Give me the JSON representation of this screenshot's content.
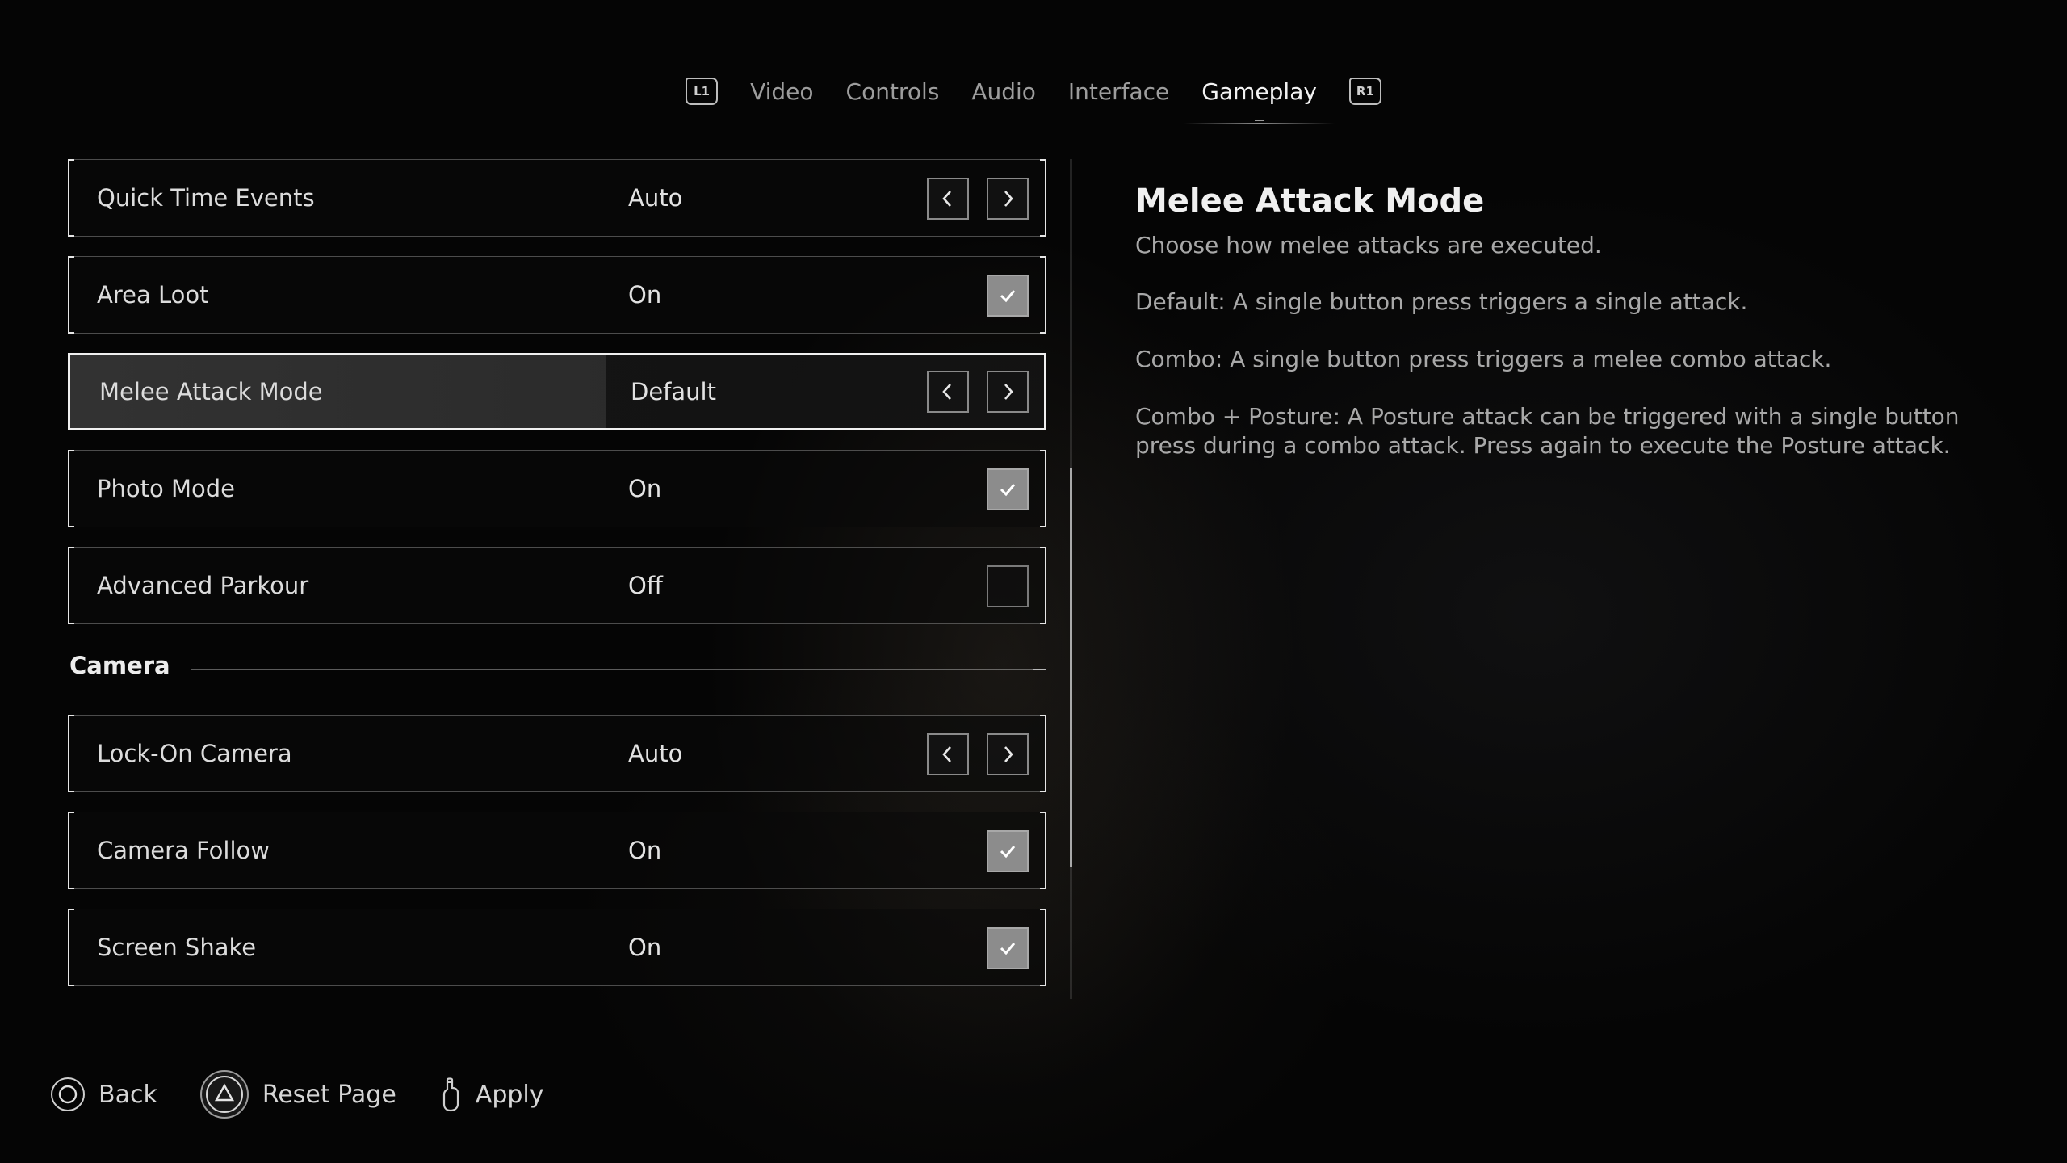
{
  "tabs": {
    "left_bumper": "L1",
    "right_bumper": "R1",
    "items": [
      {
        "label": "Video",
        "active": false
      },
      {
        "label": "Controls",
        "active": false
      },
      {
        "label": "Audio",
        "active": false
      },
      {
        "label": "Interface",
        "active": false
      },
      {
        "label": "Gameplay",
        "active": true
      }
    ]
  },
  "settings": {
    "rows": [
      {
        "label": "Quick Time Events",
        "value": "Auto",
        "control": "arrows"
      },
      {
        "label": "Area Loot",
        "value": "On",
        "control": "checkbox",
        "checked": true
      },
      {
        "label": "Melee Attack Mode",
        "value": "Default",
        "control": "arrows",
        "selected": true
      },
      {
        "label": "Photo Mode",
        "value": "On",
        "control": "checkbox",
        "checked": true
      },
      {
        "label": "Advanced Parkour",
        "value": "Off",
        "control": "checkbox",
        "checked": false
      }
    ],
    "camera_section": {
      "title": "Camera",
      "rows": [
        {
          "label": "Lock-On Camera",
          "value": "Auto",
          "control": "arrows"
        },
        {
          "label": "Camera Follow",
          "value": "On",
          "control": "checkbox",
          "checked": true
        },
        {
          "label": "Screen Shake",
          "value": "On",
          "control": "checkbox",
          "checked": true
        }
      ]
    }
  },
  "description": {
    "title": "Melee Attack Mode",
    "paragraphs": [
      "Choose how melee attacks are executed.",
      "Default: A single button press triggers a single attack.",
      "Combo: A single button press triggers a melee combo attack.",
      "Combo + Posture: A Posture attack can be triggered with a single button press during a combo attack. Press again to execute the Posture attack."
    ]
  },
  "footer": {
    "back": {
      "label": "Back",
      "icon": "circle-button-icon"
    },
    "reset": {
      "label": "Reset Page",
      "icon": "triangle-button-icon"
    },
    "apply": {
      "label": "Apply",
      "icon": "touchpad-finger-icon"
    }
  },
  "colors": {
    "background": "#050505",
    "text_primary": "#f0f0f0",
    "text_secondary": "#a8a8a8",
    "checkbox_checked": "#8c8c8c"
  }
}
